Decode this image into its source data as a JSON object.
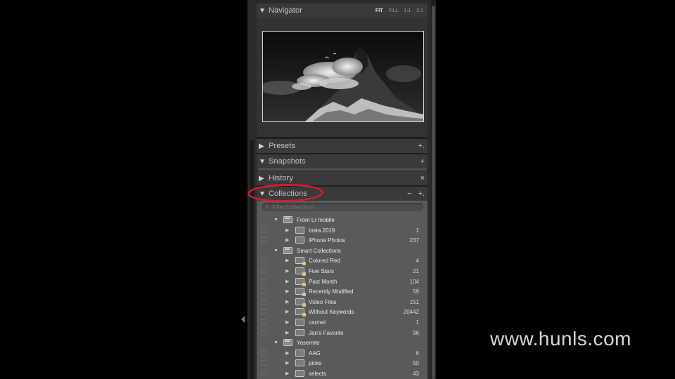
{
  "navigator": {
    "title": "Navigator",
    "zoom_options": [
      "FIT",
      "FILL",
      "1:1",
      "3:1"
    ]
  },
  "presets": {
    "title": "Presets",
    "action": "+."
  },
  "snapshots": {
    "title": "Snapshots",
    "action": "+"
  },
  "history": {
    "title": "History",
    "action": "×"
  },
  "collections": {
    "title": "Collections",
    "actions": [
      "−",
      "+."
    ],
    "filter_placeholder": "Filter Collections",
    "items": [
      {
        "name": "From Lr mobile",
        "count": "",
        "level": 1,
        "kind": "set",
        "expanded": true
      },
      {
        "name": "Insta 2019",
        "count": "1",
        "level": 2,
        "kind": "collection"
      },
      {
        "name": "iPhone Photos",
        "count": "237",
        "level": 2,
        "kind": "collection"
      },
      {
        "name": "Smart Collections",
        "count": "",
        "level": 1,
        "kind": "set",
        "expanded": true
      },
      {
        "name": "Colored Red",
        "count": "4",
        "level": 2,
        "kind": "smart"
      },
      {
        "name": "Five Stars",
        "count": "21",
        "level": 2,
        "kind": "smart"
      },
      {
        "name": "Past Month",
        "count": "104",
        "level": 2,
        "kind": "smart"
      },
      {
        "name": "Recently Modified",
        "count": "59",
        "level": 2,
        "kind": "smart"
      },
      {
        "name": "Video Files",
        "count": "151",
        "level": 2,
        "kind": "smart"
      },
      {
        "name": "Without Keywords",
        "count": "20442",
        "level": 2,
        "kind": "smart"
      },
      {
        "name": "carmel",
        "count": "1",
        "level": 2,
        "kind": "collection"
      },
      {
        "name": "Jan's Favorite",
        "count": "96",
        "level": 2,
        "kind": "collection"
      },
      {
        "name": "Yosemite",
        "count": "",
        "level": 1,
        "kind": "set",
        "expanded": true
      },
      {
        "name": "AAG",
        "count": "6",
        "level": 2,
        "kind": "collection"
      },
      {
        "name": "picks",
        "count": "50",
        "level": 2,
        "kind": "collection"
      },
      {
        "name": "selects",
        "count": "43",
        "level": 2,
        "kind": "collection"
      }
    ]
  },
  "watermark": "www.hunls.com",
  "colors": {
    "highlight_oval": "#d11f2c",
    "panel": "#2b2b2b",
    "collections_bg": "#5a5a5a"
  }
}
